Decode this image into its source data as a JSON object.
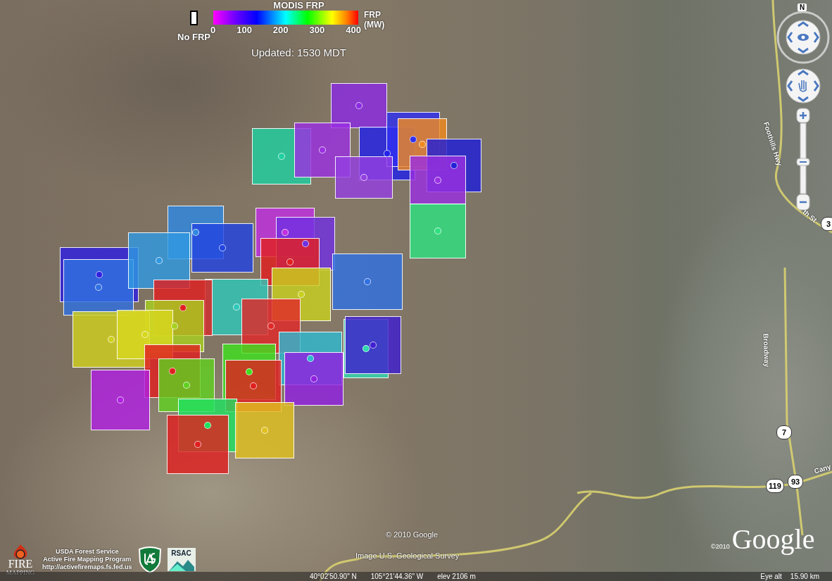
{
  "legend": {
    "title": "MODIS FRP",
    "no_frp_label": "No FRP",
    "ticks": [
      "0",
      "100",
      "200",
      "300",
      "400"
    ],
    "unit": "FRP (MW)",
    "updated": "Updated: 1530 MDT"
  },
  "detections": [
    {
      "color": "#8a2be2"
    },
    {
      "color": "#20d0a0"
    },
    {
      "color": "#9a30e0"
    },
    {
      "color": "#2222e8"
    },
    {
      "color": "#3030f0"
    },
    {
      "color": "#f08a20"
    },
    {
      "color": "#9440e0"
    },
    {
      "color": "#2020d8"
    },
    {
      "color": "#9a30e0"
    },
    {
      "color": "#30e080"
    },
    {
      "color": "#3088e0"
    },
    {
      "color": "#2244e0"
    },
    {
      "color": "#c030e0"
    },
    {
      "color": "#7030e0"
    },
    {
      "color": "#e02020"
    },
    {
      "color": "#3020e0"
    },
    {
      "color": "#3070e0"
    },
    {
      "color": "#3098e0"
    },
    {
      "color": "#3070e0"
    },
    {
      "color": "#30c8b8"
    },
    {
      "color": "#c8d020"
    },
    {
      "color": "#e02020"
    },
    {
      "color": "#e02828"
    },
    {
      "color": "#a8d020"
    },
    {
      "color": "#d0d020"
    },
    {
      "color": "#d8d820"
    },
    {
      "color": "#30d8b0"
    },
    {
      "color": "#4020d0"
    },
    {
      "color": "#30b8d0"
    },
    {
      "color": "#9020e0"
    },
    {
      "color": "#e02020"
    },
    {
      "color": "#60d020"
    },
    {
      "color": "#40e020"
    },
    {
      "color": "#e02020"
    },
    {
      "color": "#b020e0"
    },
    {
      "color": "#20e060"
    },
    {
      "color": "#e02020"
    },
    {
      "color": "#e0c020"
    }
  ],
  "map_labels": [
    {
      "kind": "road",
      "text": "Foothills Hwy"
    },
    {
      "kind": "road",
      "text": "th St"
    },
    {
      "kind": "road",
      "text": "Broadway"
    },
    {
      "kind": "road",
      "text": "Cany"
    },
    {
      "kind": "shield",
      "text": "3"
    }
  ],
  "route_shields": [
    "7",
    "119",
    "93"
  ],
  "navigation": {
    "north_label": "N",
    "zoom_slider": {
      "level": 0.5
    }
  },
  "attribution": {
    "copyright": "© 2010 Google",
    "imagery": "Image U.S. Geological Survey"
  },
  "branding": {
    "fire_logo": {
      "line_1": "FIRE",
      "line_2": "MAPPING"
    },
    "program": {
      "line_1": "USDA Forest Service",
      "line_2": "Active Fire Mapping Program",
      "url": "http://activefiremaps.fs.fed.us"
    },
    "rsac_logo": "RSAC",
    "google_logo": {
      "year": "©2010",
      "name": "Google"
    }
  },
  "status_bar": {
    "latitude": "40°02'50.90\" N",
    "longitude": "105°21'44.36\" W",
    "elevation": "elev 2106 m",
    "eye_alt_label": "Eye alt",
    "eye_alt_value": "15.90 km"
  }
}
